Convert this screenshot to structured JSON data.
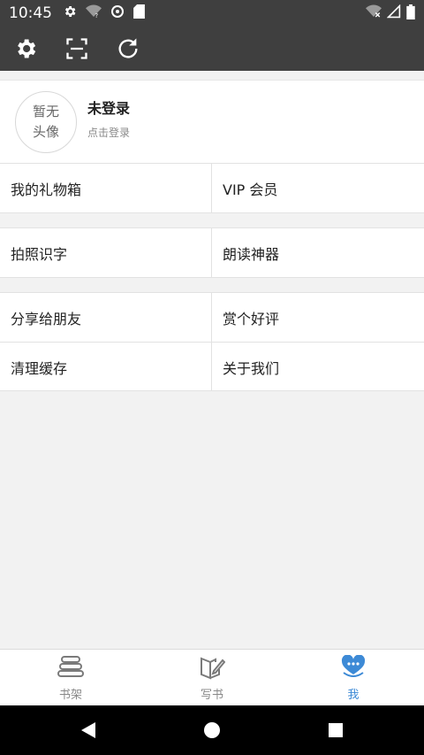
{
  "status": {
    "time": "10:45"
  },
  "toolbar": {
    "icons": [
      "gear-icon",
      "scan-icon",
      "refresh-icon"
    ]
  },
  "profile": {
    "avatar_line1": "暂无",
    "avatar_line2": "头像",
    "name": "未登录",
    "hint": "点击登录"
  },
  "menu": {
    "gift_box": "我的礼物箱",
    "vip": "VIP 会员",
    "photo_ocr": "拍照识字",
    "read_aloud": "朗读神器",
    "share": "分享给朋友",
    "rate": "赏个好评",
    "clear_cache": "清理缓存",
    "about": "关于我们"
  },
  "bottom_nav": {
    "bookshelf": "书架",
    "write": "写书",
    "me": "我"
  },
  "colors": {
    "bar": "#3f3f3f",
    "accent": "#3d8ad6"
  }
}
